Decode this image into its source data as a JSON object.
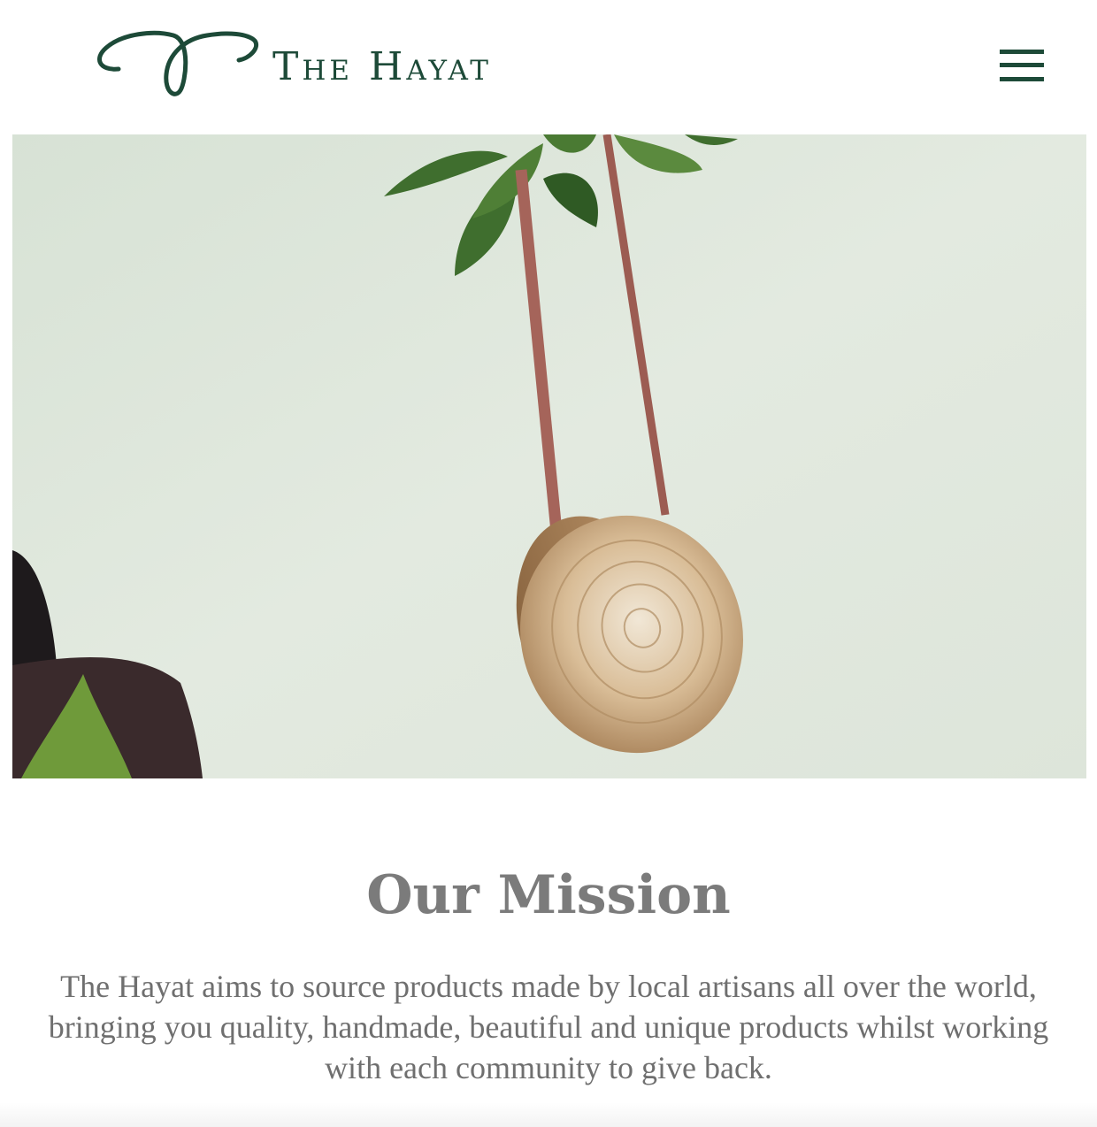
{
  "header": {
    "brand_name": "The Hayat",
    "logo_icon": "swirl-logo-icon",
    "menu_icon": "hamburger-menu-icon"
  },
  "hero": {
    "image": "rattan-bag-hanging-photo"
  },
  "mission": {
    "title": "Our Mission",
    "body": "The Hayat aims to source products made by local artisans all over the world, bringing you quality, handmade, beautiful and unique products whilst working with each community to give back."
  },
  "colors": {
    "brand_green": "#1d4a38",
    "heading_gray": "#7b7b7b",
    "body_gray": "#6f6f6f"
  }
}
